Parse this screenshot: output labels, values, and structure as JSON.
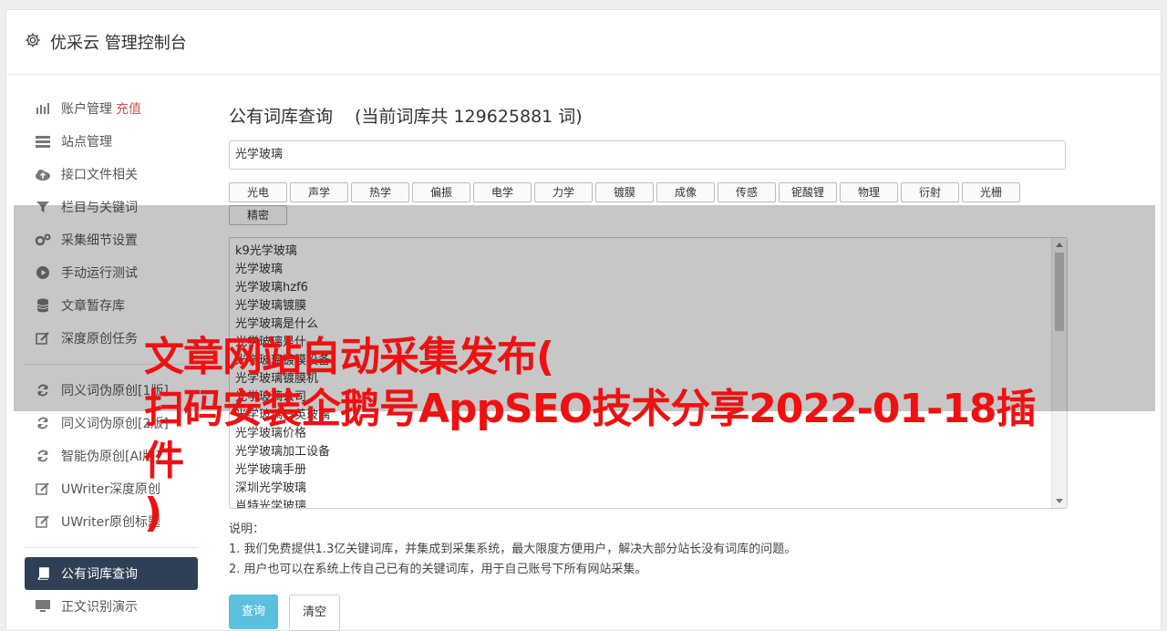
{
  "header": {
    "title": "优采云 管理控制台",
    "icon": "gear-icon"
  },
  "sidebar": {
    "group1": [
      {
        "label": "账户管理",
        "badge": "充值",
        "icon": "bar-chart-icon"
      },
      {
        "label": "站点管理",
        "icon": "server-icon"
      },
      {
        "label": "接口文件相关",
        "icon": "cloud-upload-icon"
      },
      {
        "label": "栏目与关键词",
        "icon": "filter-icon"
      },
      {
        "label": "采集细节设置",
        "icon": "gears-icon"
      },
      {
        "label": "手动运行测试",
        "icon": "play-circle-icon"
      },
      {
        "label": "文章暂存库",
        "icon": "database-icon"
      },
      {
        "label": "深度原创任务",
        "icon": "edit-icon"
      }
    ],
    "group2": [
      {
        "label": "同义词伪原创[1版]",
        "icon": "refresh-icon"
      },
      {
        "label": "同义词伪原创[2版]",
        "icon": "refresh-icon"
      },
      {
        "label": "智能伪原创[AI版]",
        "icon": "refresh-icon"
      },
      {
        "label": "UWriter深度原创",
        "icon": "edit-icon"
      },
      {
        "label": "UWriter原创标题",
        "icon": "edit-icon"
      }
    ],
    "group3": [
      {
        "label": "公有词库查询",
        "icon": "book-icon",
        "active": true
      },
      {
        "label": "正文识别演示",
        "icon": "monitor-icon"
      }
    ]
  },
  "main": {
    "title": "公有词库查询",
    "count_text": "(当前词库共 129625881 词)",
    "search_value": "光学玻璃",
    "tags": [
      "光电",
      "声学",
      "热学",
      "偏振",
      "电学",
      "力学",
      "镀膜",
      "成像",
      "传感",
      "铌酸锂",
      "物理",
      "衍射",
      "光栅",
      "精密"
    ],
    "results": [
      "k9光学玻璃",
      "光学玻璃",
      "光学玻璃hzf6",
      "光学玻璃镀膜",
      "光学玻璃是什么",
      "光学玻璃是什",
      "光学玻璃镀膜设备",
      "光学玻璃镀膜机",
      "光学玻璃公司",
      "光学玻璃石英玻璃",
      "光学玻璃价格",
      "光学玻璃加工设备",
      "光学玻璃手册",
      "深圳光学玻璃",
      "肖特光学玻璃"
    ],
    "notes_title": "说明：",
    "notes": [
      "1. 我们免费提供1.3亿关键词库，并集成到采集系统，最大限度方便用户，解决大部分站长没有词库的问题。",
      "2. 用户也可以在系统上传自己已有的关键词库，用于自己账号下所有网站采集。"
    ],
    "query_button": "查询",
    "clear_button": "清空"
  },
  "watermark": {
    "line1": "文章网站自动采集发布(",
    "line2": "扫码安装企鹅号AppSEO技术分享2022-01-18插件",
    "line3": ")"
  },
  "colors": {
    "accent": "#2f4056",
    "primary_button": "#5bc0de",
    "badge": "#d9534f",
    "watermark": "#ee1111"
  }
}
